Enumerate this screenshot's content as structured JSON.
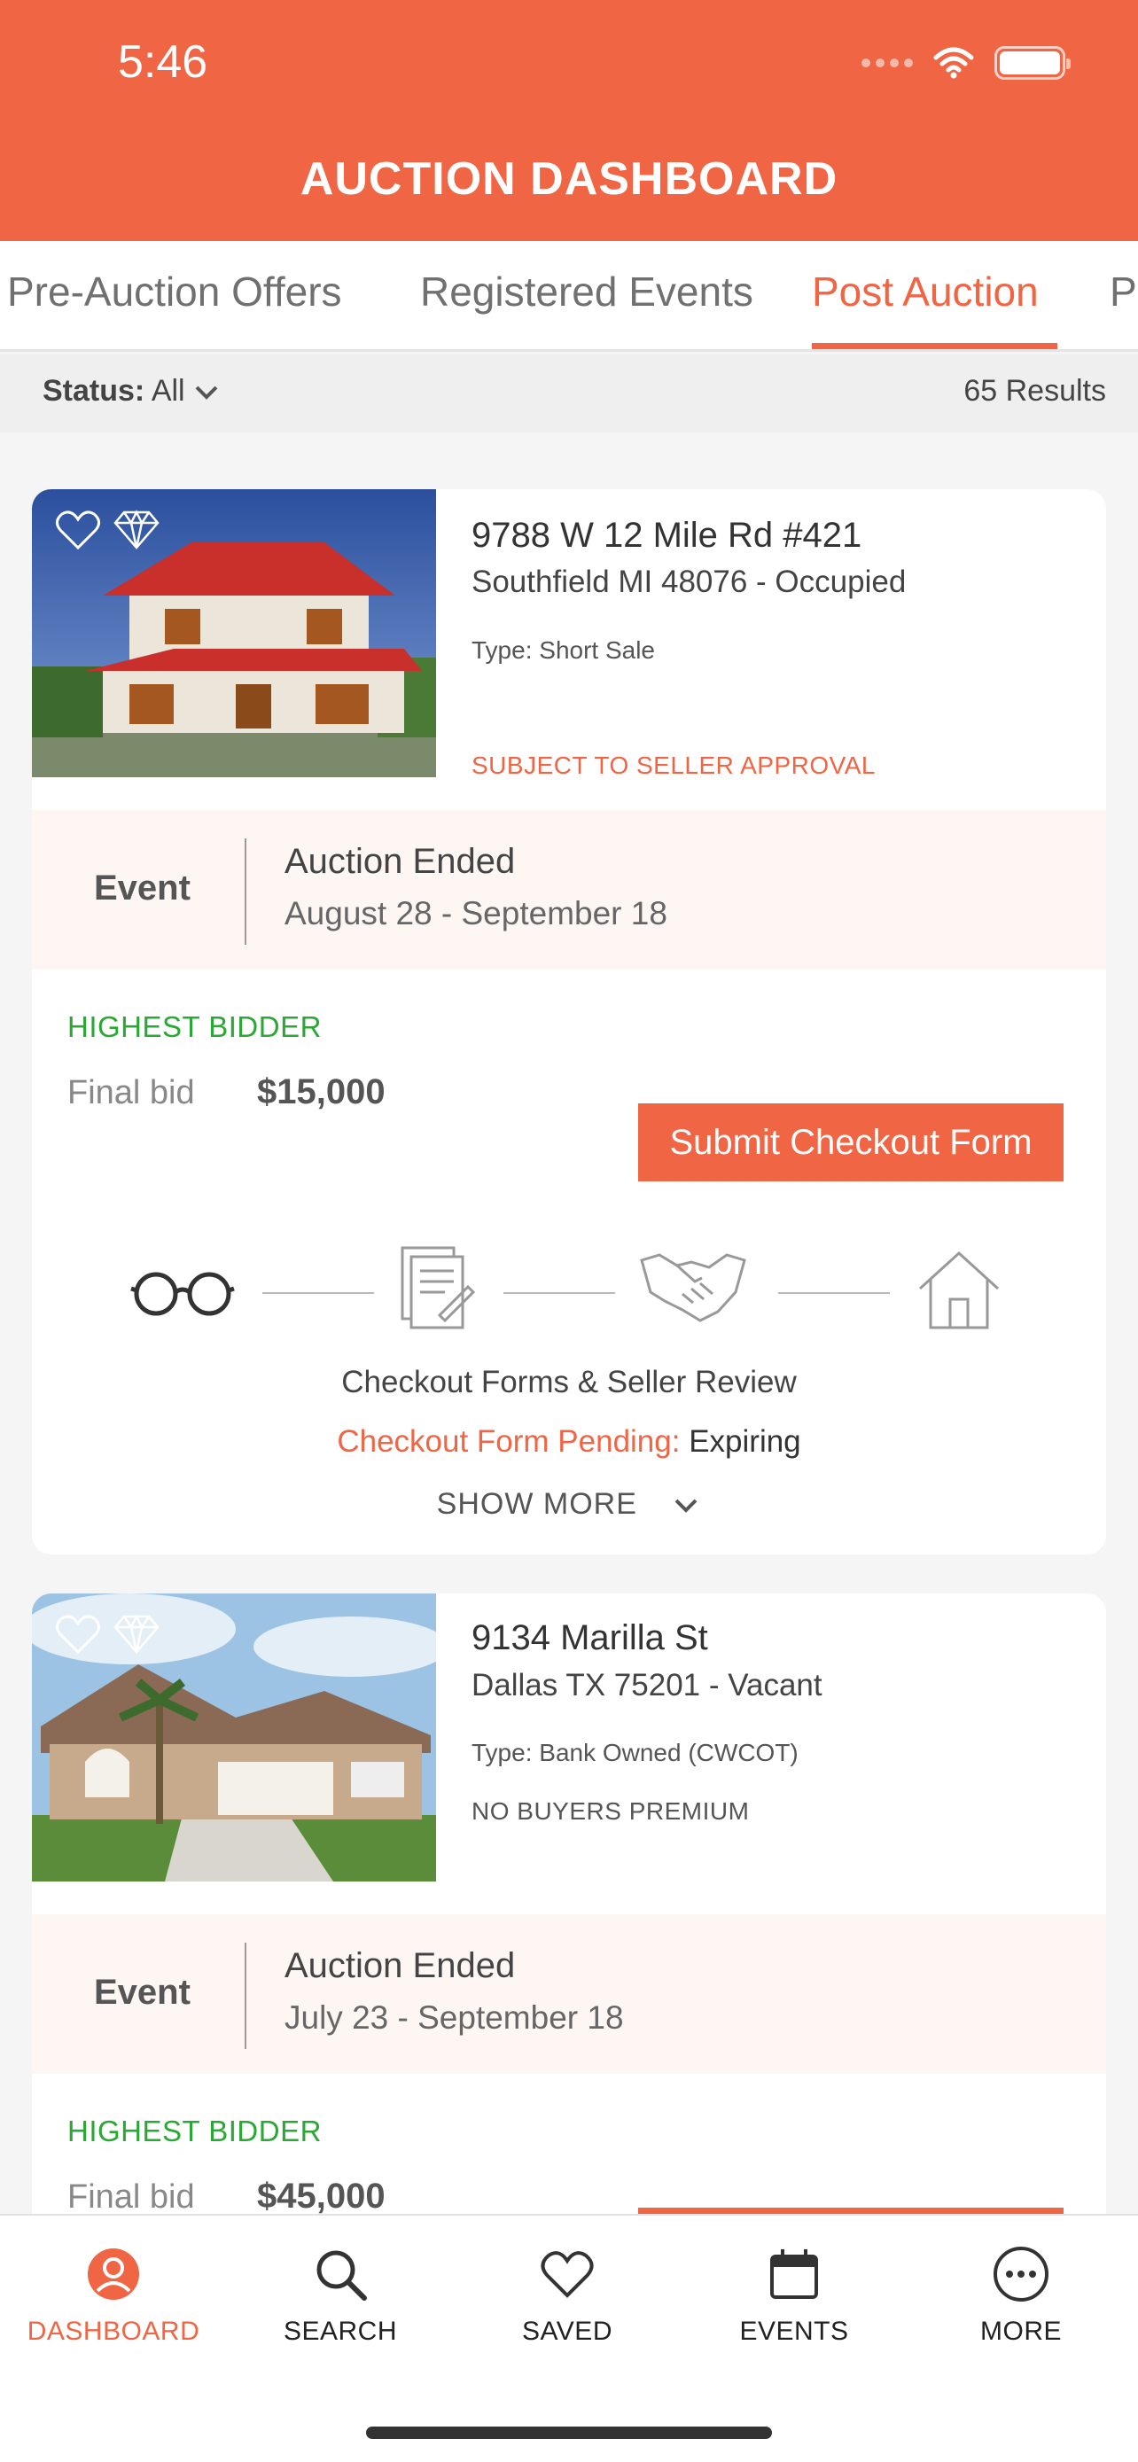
{
  "status_bar": {
    "time": "5:46"
  },
  "header": {
    "title": "AUCTION DASHBOARD"
  },
  "tabs": [
    {
      "label": "Pre-Auction Offers"
    },
    {
      "label": "Registered Events"
    },
    {
      "label": "Post Auction"
    },
    {
      "label": "P"
    }
  ],
  "filter": {
    "status_label": "Status:",
    "status_value": "All",
    "results": "65 Results"
  },
  "listings": [
    {
      "address": "9788 W 12 Mile Rd #421",
      "city": "Southfield MI 48076 - Occupied",
      "type": "Type: Short Sale",
      "tag": "SUBJECT TO SELLER APPROVAL",
      "tag_color": "#f06543",
      "event_label": "Event",
      "event_title": "Auction Ended",
      "event_dates": "August 28 - September 18",
      "bidder_status": "HIGHEST BIDDER",
      "final_label": "Final bid",
      "final_value": "$15,000",
      "button": "Submit Checkout Form",
      "step_icons": [
        "glasses-icon",
        "document-icon",
        "handshake-icon",
        "house-icon"
      ],
      "step_name": "Checkout Forms & Seller Review",
      "step_status_label": "Checkout Form Pending:",
      "step_status_value": "Expiring",
      "show_more": "SHOW MORE"
    },
    {
      "address": "9134 Marilla St",
      "city": "Dallas TX 75201 - Vacant",
      "type": "Type: Bank Owned (CWCOT)",
      "tag": "NO BUYERS PREMIUM",
      "tag_color": "#555555",
      "event_label": "Event",
      "event_title": "Auction Ended",
      "event_dates": "July 23 - September 18",
      "bidder_status": "HIGHEST BIDDER",
      "final_label": "Final bid",
      "final_value": "$45,000"
    }
  ],
  "tabbar": [
    {
      "label": "DASHBOARD",
      "icon": "user-circle-icon"
    },
    {
      "label": "SEARCH",
      "icon": "search-icon"
    },
    {
      "label": "SAVED",
      "icon": "heart-icon"
    },
    {
      "label": "EVENTS",
      "icon": "calendar-icon"
    },
    {
      "label": "MORE",
      "icon": "more-icon"
    }
  ],
  "colors": {
    "brand": "#f06543",
    "success": "#2aa835"
  }
}
